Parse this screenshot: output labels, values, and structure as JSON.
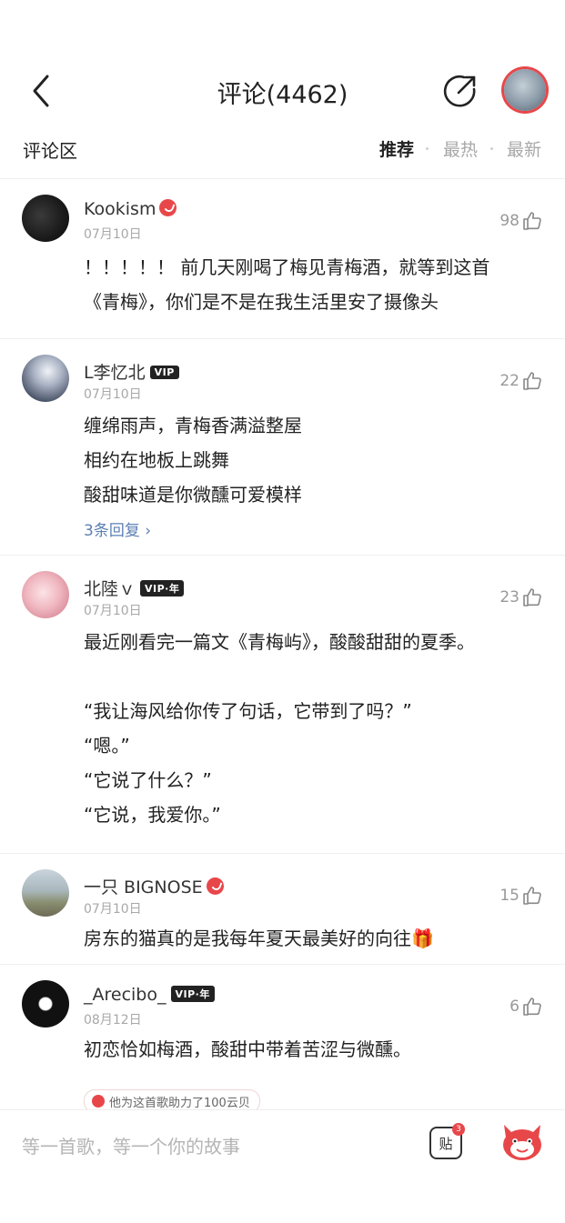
{
  "header": {
    "title": "评论(4462)"
  },
  "subheader": {
    "section_title": "评论区",
    "sort_tabs": [
      "推荐",
      "最热",
      "最新"
    ]
  },
  "comments": [
    {
      "username": "Kookism",
      "date": "07月10日",
      "likes": "98",
      "text": "！！！！！ 前几天刚喝了梅见青梅酒，就等到这首\n《青梅》，你们是不是在我生活里安了摄像头",
      "badge": "verified"
    },
    {
      "username": "L李忆北",
      "date": "07月10日",
      "likes": "22",
      "text": "缠绵雨声，青梅香满溢整屋\n相约在地板上跳舞\n酸甜味道是你微醺可爱模样",
      "replies": "3条回复",
      "badge_text": "VIP"
    },
    {
      "username": "北陸ｖ",
      "date": "07月10日",
      "likes": "23",
      "text": "最近刚看完一篇文《青梅屿》，酸酸甜甜的夏季。\n\n“我让海风给你传了句话，它带到了吗？”\n“嗯。”\n“它说了什么？”\n“它说，我爱你。”",
      "badge_text": "VIP·年"
    },
    {
      "username": "一只 BIGNOSE",
      "date": "07月10日",
      "likes": "15",
      "text": "房东的猫真的是我每年夏天最美好的向往🎁",
      "badge": "verified"
    },
    {
      "username": "_Arecibo_",
      "date": "08月12日",
      "likes": "6",
      "text": "初恋恰如梅酒，酸甜中带着苦涩与微醺。",
      "badge_text": "VIP·年",
      "boost": "他为这首歌助力了100云贝"
    }
  ],
  "bottom": {
    "placeholder": "等一首歌，等一个你的故事",
    "sticker_label": "贴",
    "sticker_count": "3"
  }
}
